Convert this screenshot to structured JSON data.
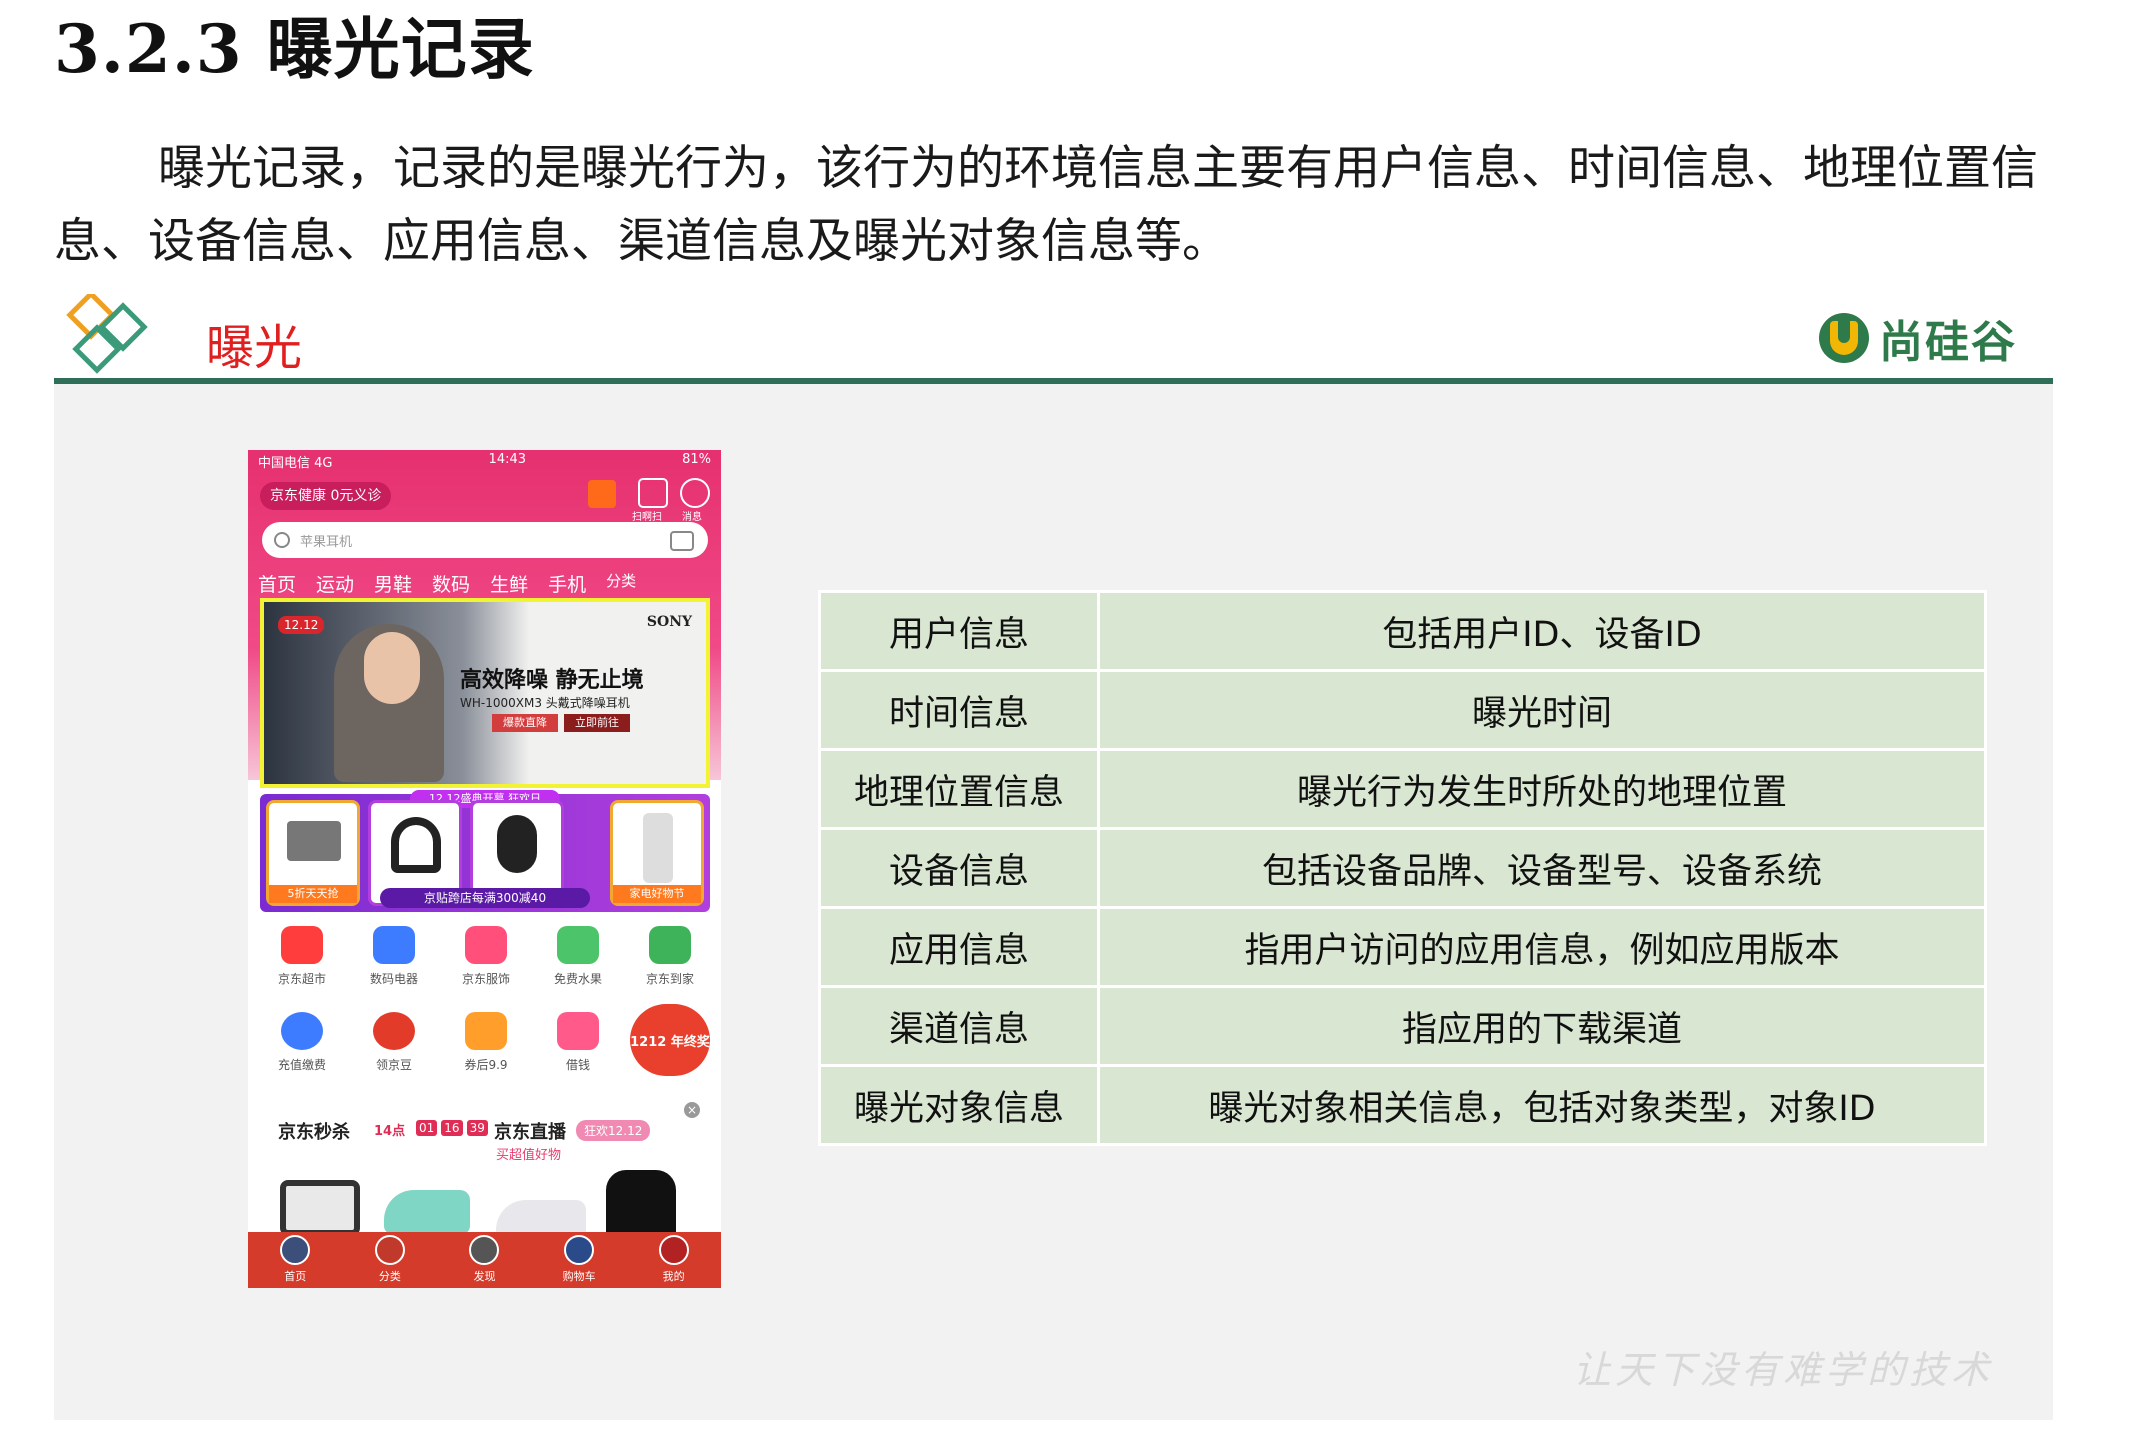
{
  "section": {
    "heading": "3.2.3 曝光记录",
    "paragraph": "曝光记录，记录的是曝光行为，该行为的环境信息主要有用户信息、时间信息、地理位置信息、设备信息、应用信息、渠道信息及曝光对象信息等。"
  },
  "slide": {
    "title": "曝光",
    "brand": "尚硅谷",
    "watermark": "让天下没有难学的技术",
    "accent_color": "#2f6f5a",
    "title_color": "#e02020"
  },
  "phone": {
    "status_left": "中国电信 4G",
    "status_time": "14:43",
    "status_right": "81%",
    "promo": "京东健康 0元义诊",
    "scan_label": "扫啊扫",
    "msg_label": "消息",
    "search_placeholder": "苹果耳机",
    "categories": [
      "首页",
      "运动",
      "男鞋",
      "数码",
      "生鲜",
      "手机",
      "分类"
    ],
    "banner": {
      "badge": "12.12",
      "brand": "SONY",
      "headline": "高效降噪 静无止境",
      "model": "WH-1000XM3 头戴式降噪耳机",
      "btn1": "爆款直降",
      "btn2": "立即前往"
    },
    "promo_strip": {
      "top_label": "12.12盛典开幕 狂欢日",
      "left_caption": "5折天天抢",
      "center_caption": "京贴跨店每满300减40",
      "right_caption": "家电好物节"
    },
    "icons_row1": [
      "京东超市",
      "数码电器",
      "京东服饰",
      "免费水果",
      "京东到家"
    ],
    "icons_row2": [
      "充值缴费",
      "领京豆",
      "券后9.9",
      "借钱"
    ],
    "float_badge": "1212 年终奖",
    "seckill": {
      "title": "京东秒杀",
      "hour": "14点",
      "timer": [
        "01",
        "16",
        "39"
      ],
      "live": "京东直播",
      "live_badge": "狂欢12.12",
      "live_sub": "买超值好物"
    },
    "tabs": [
      "首页",
      "分类",
      "发现",
      "购物车",
      "我的"
    ]
  },
  "table": {
    "rows": [
      {
        "key": "用户信息",
        "value": "包括用户ID、设备ID"
      },
      {
        "key": "时间信息",
        "value": "曝光时间"
      },
      {
        "key": "地理位置信息",
        "value": "曝光行为发生时所处的地理位置"
      },
      {
        "key": "设备信息",
        "value": "包括设备品牌、设备型号、设备系统"
      },
      {
        "key": "应用信息",
        "value": "指用户访问的应用信息，例如应用版本"
      },
      {
        "key": "渠道信息",
        "value": "指应用的下载渠道"
      },
      {
        "key": "曝光对象信息",
        "value": "曝光对象相关信息，包括对象类型，对象ID"
      }
    ],
    "cell_color": "#d9e6d1"
  }
}
